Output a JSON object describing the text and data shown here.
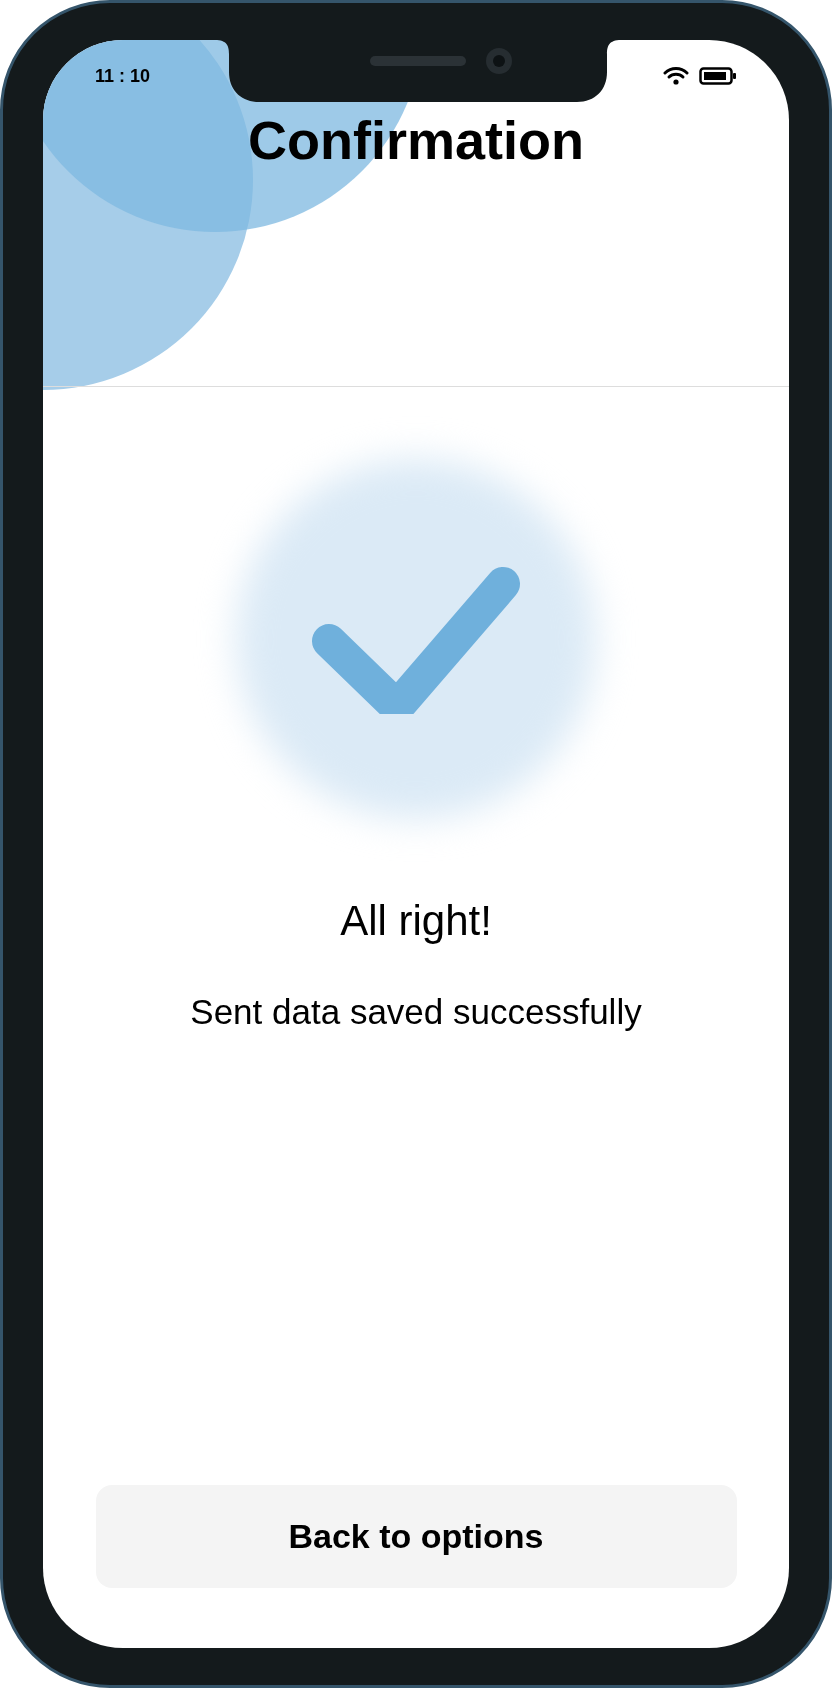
{
  "status_bar": {
    "time": "11 : 10"
  },
  "header": {
    "title": "Confirmation"
  },
  "message": {
    "title": "All right!",
    "text": "Sent data saved successfully"
  },
  "button": {
    "label": "Back to options"
  }
}
